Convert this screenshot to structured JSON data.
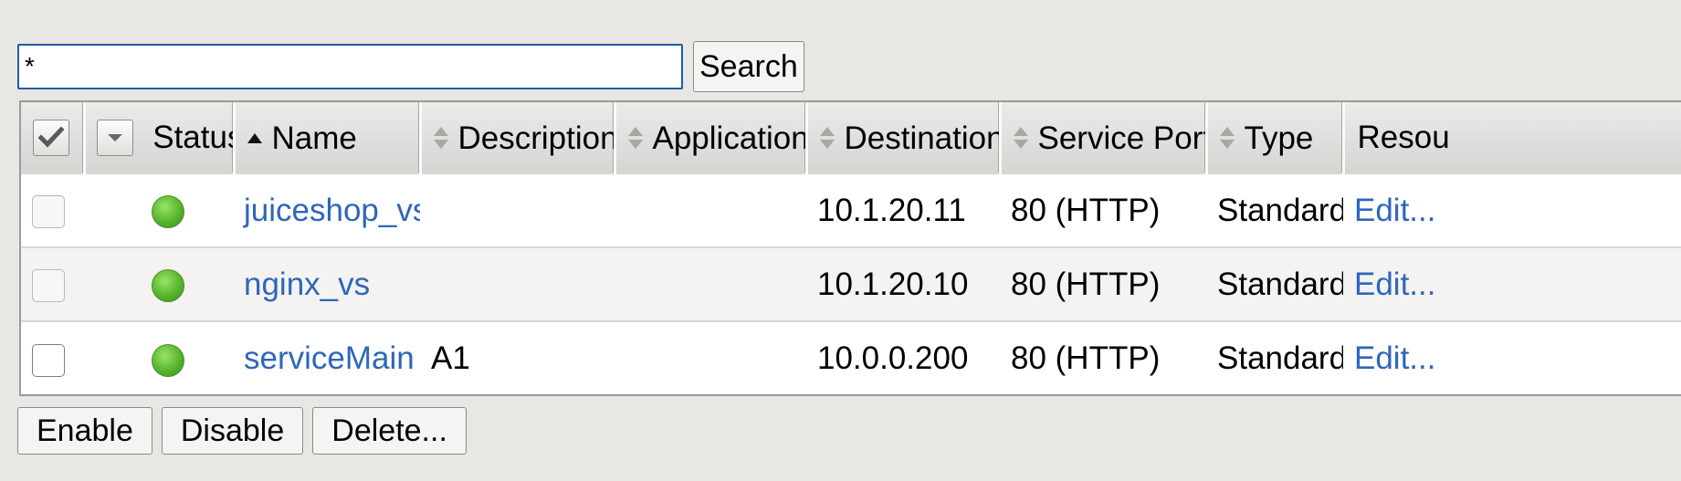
{
  "search": {
    "value": "*",
    "button_label": "Search"
  },
  "columns": {
    "status": "Status",
    "name": "Name",
    "description": "Description",
    "application": "Application",
    "destination": "Destination",
    "service_port": "Service Port",
    "type": "Type",
    "resources": "Resou"
  },
  "rows": [
    {
      "name": "juiceshop_vs",
      "description": "",
      "application": "",
      "destination": "10.1.20.11",
      "service_port": "80 (HTTP)",
      "type": "Standard",
      "resources": "Edit...",
      "status": "green",
      "checkbox_enabled": false
    },
    {
      "name": "nginx_vs",
      "description": "",
      "application": "",
      "destination": "10.1.20.10",
      "service_port": "80 (HTTP)",
      "type": "Standard",
      "resources": "Edit...",
      "status": "green",
      "checkbox_enabled": false
    },
    {
      "name": "serviceMain",
      "description": "A1",
      "application": "",
      "destination": "10.0.0.200",
      "service_port": "80 (HTTP)",
      "type": "Standard",
      "resources": "Edit...",
      "status": "green",
      "checkbox_enabled": true
    }
  ],
  "actions": {
    "enable": "Enable",
    "disable": "Disable",
    "delete": "Delete..."
  },
  "colors": {
    "link": "#2f66b8",
    "status_green": "#57b52b",
    "focus_border": "#1f5da6"
  },
  "icons": {
    "select_all": "checkmark-icon",
    "status_menu": "chevron-down-icon",
    "sort_asc": "sort-ascending-icon",
    "sort_both": "sort-both-icon"
  }
}
